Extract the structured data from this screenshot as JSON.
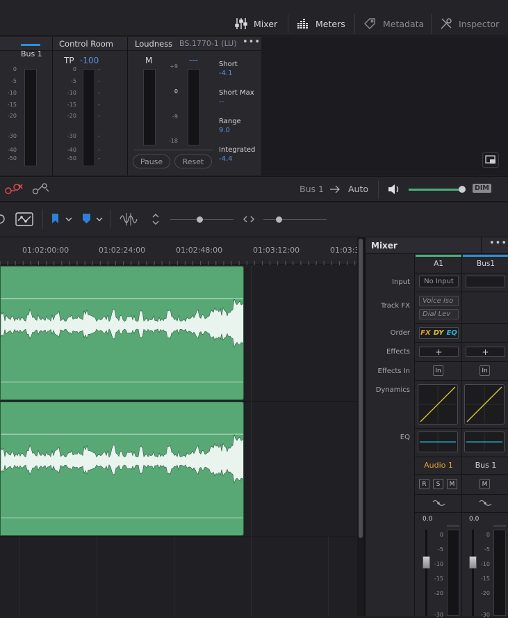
{
  "topbar": {
    "mixer_label": "Mixer",
    "meters_label": "Meters",
    "metadata_label": "Metadata",
    "inspector_label": "Inspector"
  },
  "meters": {
    "bus_title": "Bus 1",
    "control_room_title": "Control Room",
    "tp_label": "TP",
    "tp_value": "-100",
    "loudness_title": "Loudness",
    "loudness_standard": "BS.1770-1 (LU)",
    "m_label": "M",
    "m_value": "---",
    "bus_scale": [
      "0",
      "-5",
      "-10",
      "-15",
      "-20",
      "-30",
      "-40",
      "-50"
    ],
    "cr_scale": [
      "0",
      "-5",
      "-10",
      "-15",
      "-20",
      "-30",
      "-40",
      "-50"
    ],
    "lu_scale": [
      "+9",
      "0",
      "-9",
      "-18"
    ],
    "short_label": "Short",
    "short_value": "-4.1",
    "short_max_label": "Short Max",
    "short_max_value": "--",
    "range_label": "Range",
    "range_value": "9.0",
    "integrated_label": "Integrated",
    "integrated_value": "-4.4",
    "pause_label": "Pause",
    "reset_label": "Reset"
  },
  "monitor": {
    "bus_label": "Bus 1",
    "auto_label": "Auto",
    "dim_label": "DIM",
    "volume_level": 0.96
  },
  "ruler": {
    "times": [
      "01:02:00:00",
      "01:02:24:00",
      "01:02:48:00",
      "01:03:12:00",
      "01:03:3"
    ]
  },
  "mixer": {
    "title": "Mixer",
    "col1_name": "A1",
    "col2_name": "Bus1",
    "rows": {
      "input": "Input",
      "track_fx": "Track FX",
      "order": "Order",
      "effects": "Effects",
      "effects_in": "Effects In",
      "dynamics": "Dynamics",
      "eq": "EQ"
    },
    "input_value": "No Input",
    "fx1": "Voice Iso",
    "fx2": "Dial Lev",
    "order_fx": "FX",
    "order_dy": "DY",
    "order_eq": "EQ",
    "add_symbol": "+",
    "in_label": "In",
    "track1_name": "Audio 1",
    "track2_name": "Bus 1",
    "r_label": "R",
    "s_label": "S",
    "m_label": "M",
    "fader1_value": "0.0",
    "fader2_value": "0.0",
    "fader_scale": [
      "0",
      "-5",
      "-10",
      "-15",
      "-20",
      "-30"
    ],
    "accent_green": "#4caf7a",
    "accent_blue": "#2f8fd8",
    "accent_orange": "#e0a030"
  }
}
